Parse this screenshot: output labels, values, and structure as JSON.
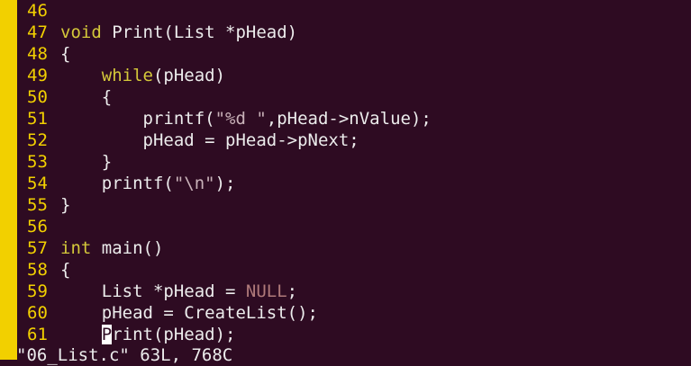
{
  "editor": {
    "status_line": "\"06_List.c\" 63L, 768C",
    "lines": [
      {
        "num": "46",
        "segs": []
      },
      {
        "num": "47",
        "segs": [
          {
            "t": "void",
            "c": "kw"
          },
          {
            "t": " Print(List *pHead)",
            "c": ""
          }
        ]
      },
      {
        "num": "48",
        "segs": [
          {
            "t": "{",
            "c": ""
          }
        ]
      },
      {
        "num": "49",
        "segs": [
          {
            "t": "    ",
            "c": ""
          },
          {
            "t": "while",
            "c": "kw"
          },
          {
            "t": "(pHead)",
            "c": ""
          }
        ]
      },
      {
        "num": "50",
        "segs": [
          {
            "t": "    {",
            "c": ""
          }
        ]
      },
      {
        "num": "51",
        "segs": [
          {
            "t": "        printf(",
            "c": ""
          },
          {
            "t": "\"%d \"",
            "c": "str"
          },
          {
            "t": ",pHead->nValue);",
            "c": ""
          }
        ]
      },
      {
        "num": "52",
        "segs": [
          {
            "t": "        pHead = pHead->pNext;",
            "c": ""
          }
        ]
      },
      {
        "num": "53",
        "segs": [
          {
            "t": "    }",
            "c": ""
          }
        ]
      },
      {
        "num": "54",
        "segs": [
          {
            "t": "    printf(",
            "c": ""
          },
          {
            "t": "\"\\n\"",
            "c": "str"
          },
          {
            "t": ");",
            "c": ""
          }
        ]
      },
      {
        "num": "55",
        "segs": [
          {
            "t": "}",
            "c": ""
          }
        ]
      },
      {
        "num": "56",
        "segs": []
      },
      {
        "num": "57",
        "segs": [
          {
            "t": "int",
            "c": "kw"
          },
          {
            "t": " main()",
            "c": ""
          }
        ]
      },
      {
        "num": "58",
        "segs": [
          {
            "t": "{",
            "c": ""
          }
        ]
      },
      {
        "num": "59",
        "segs": [
          {
            "t": "    List *pHead = ",
            "c": ""
          },
          {
            "t": "NULL",
            "c": "null"
          },
          {
            "t": ";",
            "c": ""
          }
        ]
      },
      {
        "num": "60",
        "segs": [
          {
            "t": "    pHead = CreateList();",
            "c": ""
          }
        ]
      },
      {
        "num": "61",
        "segs": [
          {
            "t": "    ",
            "c": ""
          },
          {
            "t": "P",
            "c": "cursor"
          },
          {
            "t": "rint(pHead);",
            "c": ""
          }
        ]
      }
    ]
  }
}
